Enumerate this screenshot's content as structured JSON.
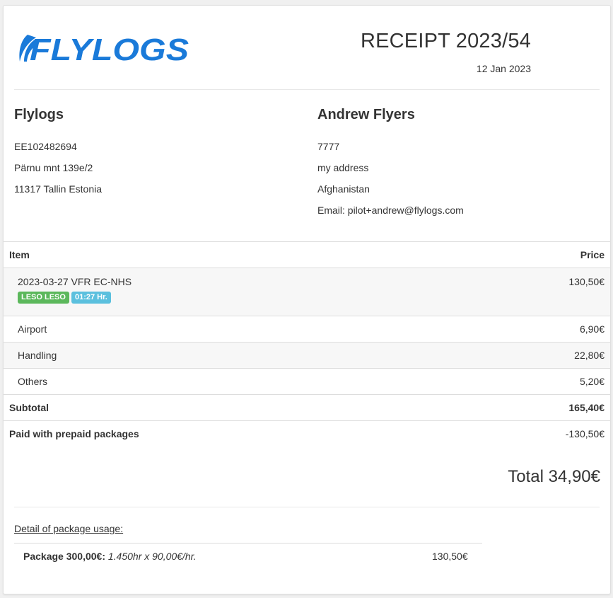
{
  "brand": {
    "logo_text": "FLYLOGS",
    "color": "#1a7ad9"
  },
  "receipt": {
    "title": "RECEIPT 2023/54",
    "date": "12 Jan 2023"
  },
  "seller": {
    "name": "Flylogs",
    "lines": [
      "EE102482694",
      "Pärnu mnt 139e/2",
      "11317 Tallin Estonia"
    ]
  },
  "buyer": {
    "name": "Andrew Flyers",
    "lines": [
      "7777",
      "my address",
      "Afghanistan",
      "Email: pilot+andrew@flylogs.com"
    ]
  },
  "table": {
    "headers": {
      "item": "Item",
      "price": "Price"
    },
    "rows": [
      {
        "item": "2023-03-27 VFR EC-NHS",
        "price": "130,50€",
        "labels": [
          "LESO LESO",
          "01:27 Hr."
        ]
      },
      {
        "item": "Airport",
        "price": "6,90€"
      },
      {
        "item": "Handling",
        "price": "22,80€"
      },
      {
        "item": "Others",
        "price": "5,20€"
      }
    ],
    "subtotal": {
      "label": "Subtotal",
      "value": "165,40€"
    },
    "prepaid": {
      "label": "Paid with prepaid packages",
      "value": "-130,50€"
    }
  },
  "total": "Total 34,90€",
  "package_usage": {
    "title": "Detail of package usage:",
    "name": "Package 300,00€:",
    "formula": "1.450hr x 90,00€/hr.",
    "amount": "130,50€"
  },
  "colors": {
    "label_green": "#5cb85c",
    "label_blue": "#5bc0de"
  }
}
